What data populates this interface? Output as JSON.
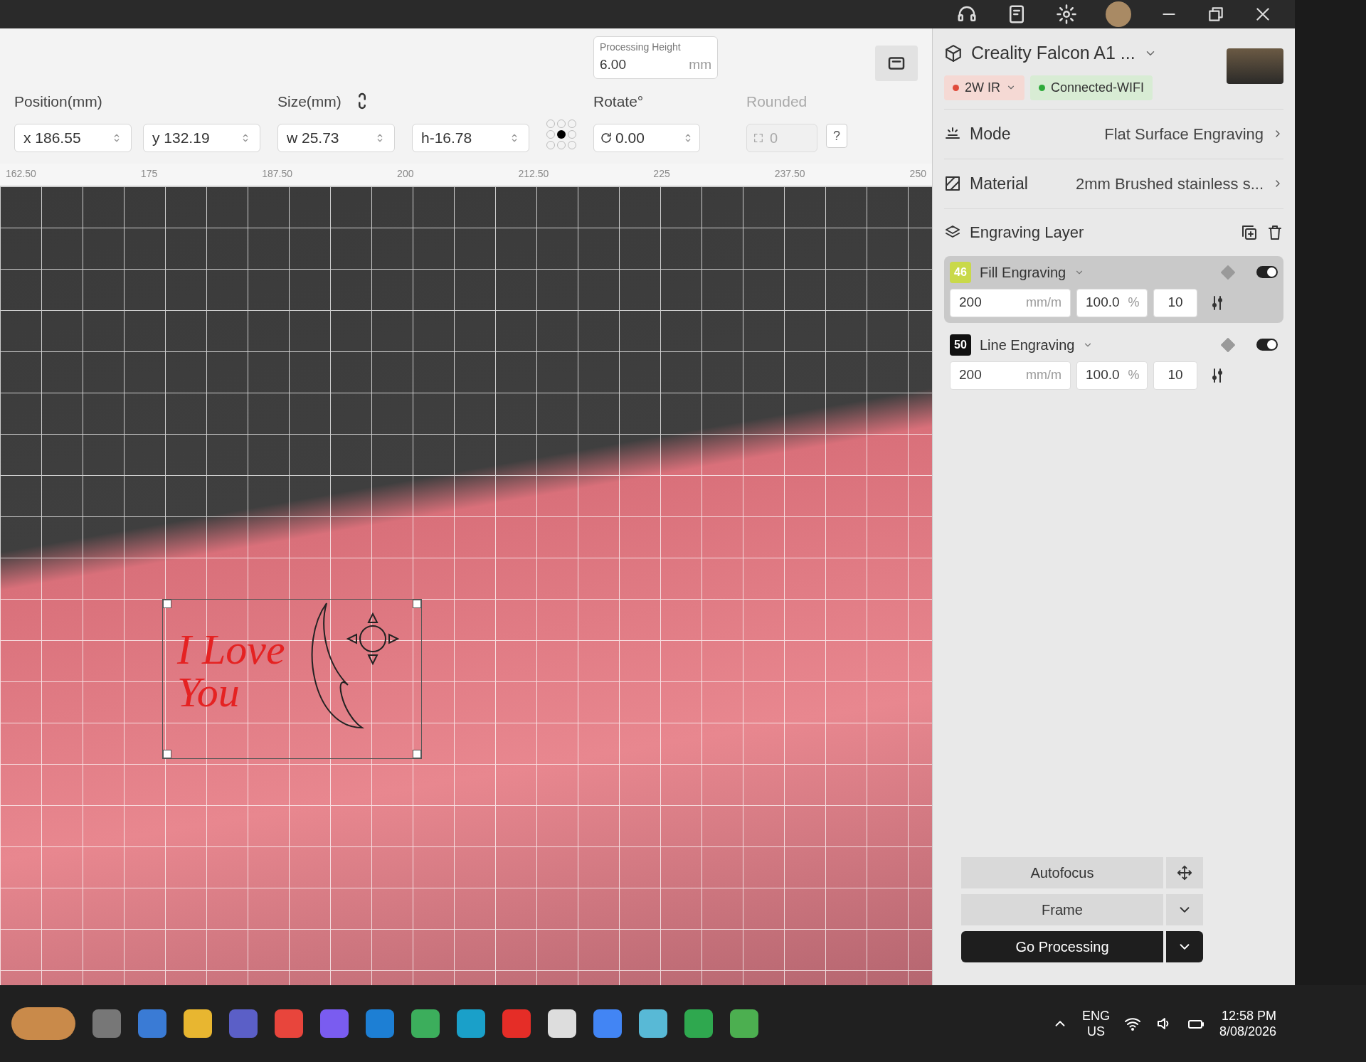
{
  "toolbar": {
    "position": {
      "label": "Position(mm)",
      "x": "x 186.55",
      "y": "y 132.19"
    },
    "size": {
      "label": "Size(mm)",
      "w": "w 25.73",
      "h": "h-16.78",
      "locked": true
    },
    "processing_height": {
      "label": "Processing Height",
      "value": "6.00",
      "unit": "mm"
    },
    "rotate": {
      "label": "Rotate°",
      "value": "0.00"
    },
    "rounded": {
      "label": "Rounded",
      "value": "0",
      "disabled": true,
      "help": "?"
    }
  },
  "ruler": [
    "162.50",
    "175",
    "187.50",
    "200",
    "212.50",
    "225",
    "237.50",
    "250"
  ],
  "canvas": {
    "design_text": "I Love You"
  },
  "device": {
    "name": "Creality Falcon A1 ...",
    "laser": "2W IR",
    "connection": "Connected-WIFI"
  },
  "settings": [
    {
      "label": "Mode",
      "value": "Flat Surface Engraving"
    },
    {
      "label": "Material",
      "value": "2mm Brushed stainless s..."
    }
  ],
  "layers_title": "Engraving Layer",
  "layers": [
    {
      "number": "46",
      "name": "Fill Engraving",
      "color": "#c9d94a",
      "selected": true,
      "on": true,
      "speed": "200",
      "speed_unit": "mm/m",
      "power": "100.0",
      "power_unit": "%",
      "passes": "10"
    },
    {
      "number": "50",
      "name": "Line Engraving",
      "color": "#111111",
      "selected": false,
      "on": true,
      "speed": "200",
      "speed_unit": "mm/m",
      "power": "100.0",
      "power_unit": "%",
      "passes": "10"
    }
  ],
  "actions": {
    "autofocus": "Autofocus",
    "frame": "Frame",
    "go": "Go Processing"
  },
  "taskbar": {
    "language": "ENG",
    "region": "US",
    "time": "12:58 PM",
    "date": "8/08/2026"
  }
}
